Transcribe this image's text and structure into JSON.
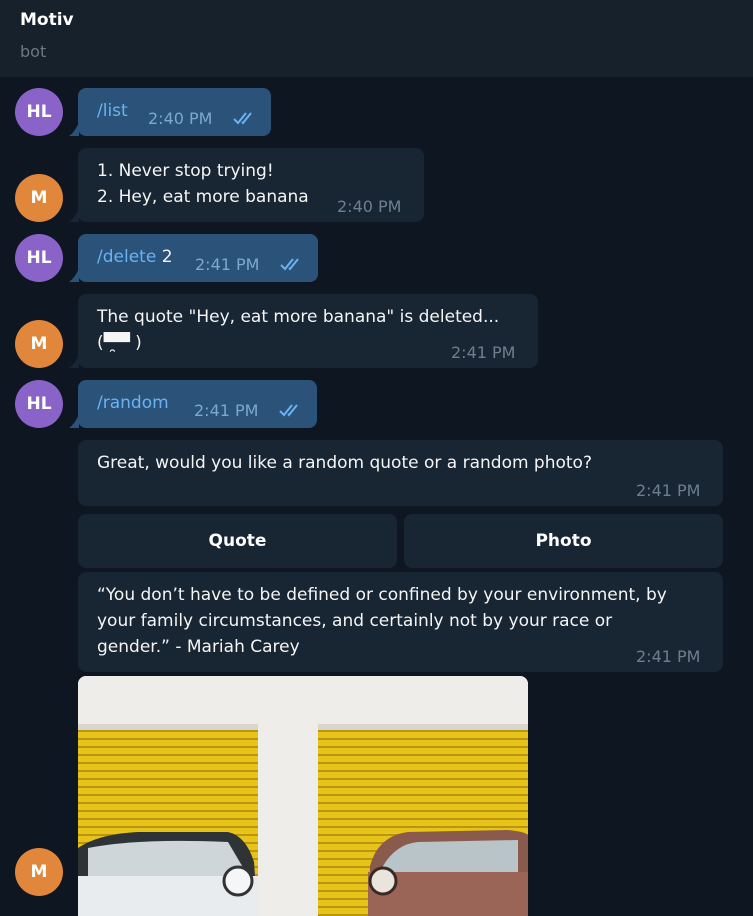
{
  "header": {
    "title": "Motiv",
    "subtitle": "bot"
  },
  "avatars": {
    "user": "HL",
    "bot": "M"
  },
  "messages": {
    "m1": {
      "command": "/list",
      "time": "2:40 PM"
    },
    "m2": {
      "line1": "1. Never stop trying!",
      "line2": "2. Hey, eat more banana",
      "time": "2:40 PM"
    },
    "m3": {
      "command": "/delete",
      "arg": " 2",
      "time": "2:41 PM"
    },
    "m4": {
      "line1": "The quote \"Hey, eat more banana\" is deleted...",
      "line2": "(▀̯▀ )",
      "time": "2:41 PM"
    },
    "m5": {
      "command": "/random",
      "time": "2:41 PM"
    },
    "m6": {
      "text": "Great, would you like a random quote or a random photo?",
      "time": "2:41 PM"
    },
    "m7": {
      "line1": "“You don’t have to be defined or confined by your environment, by",
      "line2": "your family circumstances, and certainly not by your race or",
      "line3": "gender.” - Mariah Carey",
      "time": "2:41 PM"
    }
  },
  "keyboard": {
    "quote_label": "Quote",
    "photo_label": "Photo"
  },
  "colors": {
    "background": "#0e1621",
    "header": "#17212b",
    "outgoing_bubble": "#2b5278",
    "incoming_bubble": "#182533",
    "command_link": "#6ab3f3",
    "avatar_user": "#8a63c9",
    "avatar_bot": "#e0873c"
  },
  "icons": {
    "read_status": "double-check-icon"
  }
}
